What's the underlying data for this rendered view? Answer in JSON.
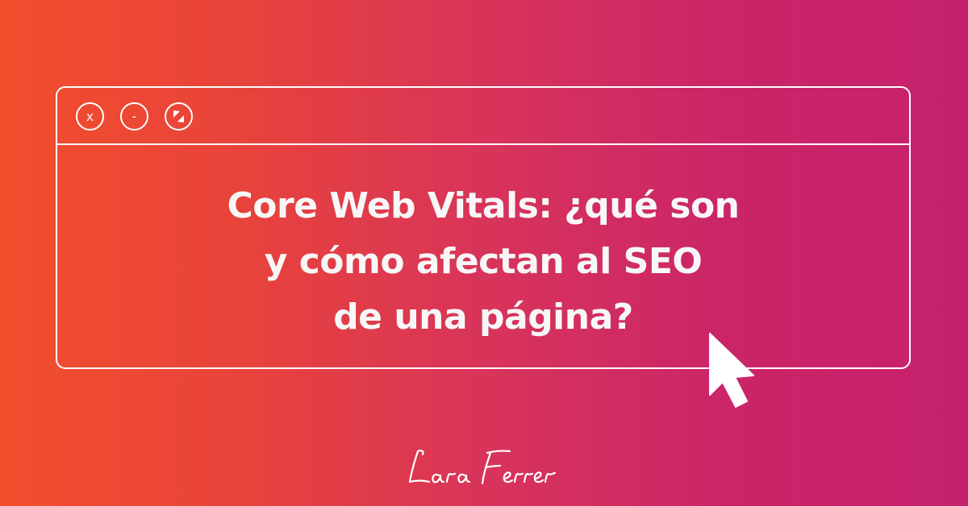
{
  "window": {
    "controls": {
      "close_label": "x",
      "minimize_label": "-",
      "maximize_icon": "expand-arrows-icon"
    }
  },
  "headline": {
    "line1": "Core Web Vitals: ¿qué son",
    "line2": "y cómo afectan al SEO",
    "line3": "de una página?"
  },
  "cursor_icon": "mouse-pointer-icon",
  "signature": {
    "text": "Lara Ferrer"
  },
  "colors": {
    "gradient_left": "#f24e2c",
    "gradient_right": "#c6216d",
    "foreground": "#ffffff"
  }
}
